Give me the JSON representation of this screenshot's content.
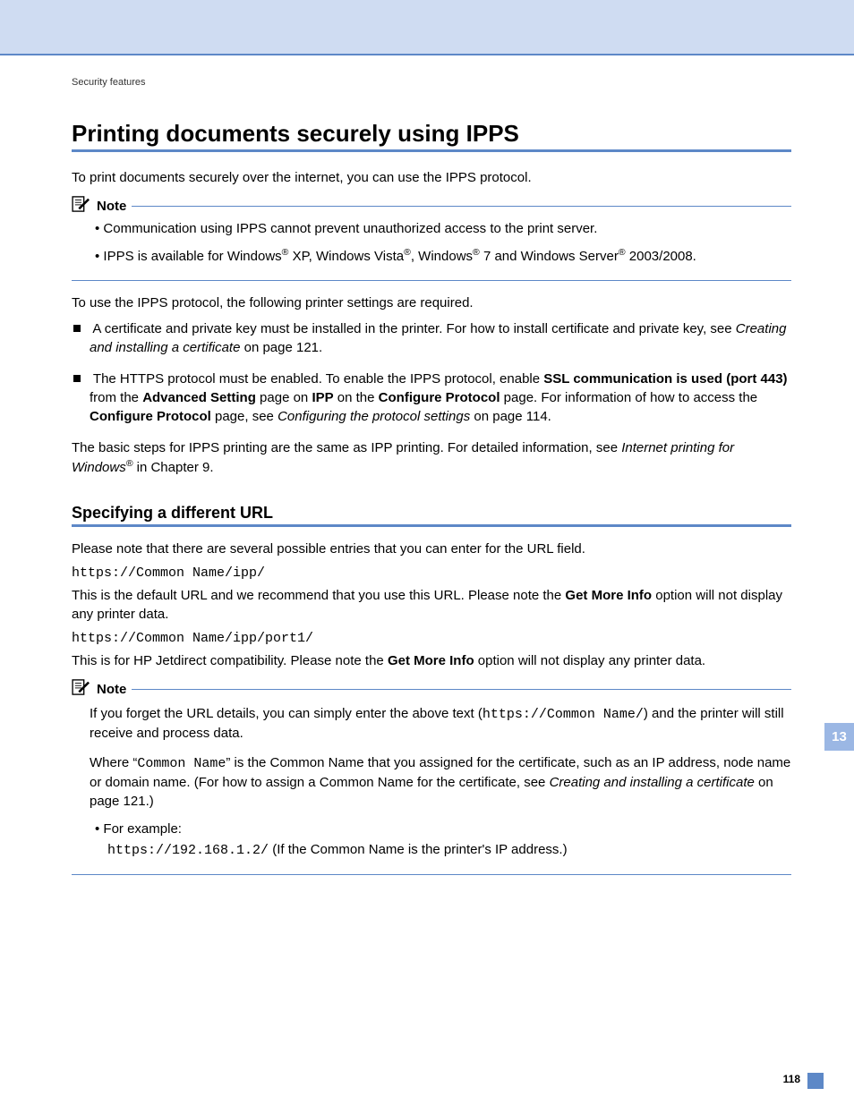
{
  "running_head": "Security features",
  "h1": "Printing documents securely using IPPS",
  "intro": "To print documents securely over the internet, you can use the IPPS protocol.",
  "note1": {
    "label": "Note",
    "b1": "Communication using IPPS cannot prevent unauthorized access to the print server.",
    "b2_pre": "IPPS is available for Windows",
    "b2_mid1": " XP, Windows Vista",
    "b2_mid2": ", Windows",
    "b2_mid3": " 7 and Windows Server",
    "b2_post": " 2003/2008."
  },
  "req_intro": "To use the IPPS protocol, the following printer settings are required.",
  "req": {
    "li1_a": "A certificate and private key must be installed in the printer. For how to install certificate and private key, see ",
    "li1_em": "Creating and installing a certificate",
    "li1_b": " on page 121.",
    "li2_a": "The HTTPS protocol must be enabled. To enable the IPPS protocol, enable ",
    "li2_b1": "SSL communication is used (port 443)",
    "li2_c": " from the ",
    "li2_b2": "Advanced Setting",
    "li2_d": " page on ",
    "li2_b3": "IPP",
    "li2_e": " on the ",
    "li2_b4": "Configure Protocol",
    "li2_f": " page. For information of how to access the ",
    "li2_b5": "Configure Protocol",
    "li2_g": " page, see ",
    "li2_em": "Configuring the protocol settings",
    "li2_h": " on page 114."
  },
  "basic_a": "The basic steps for IPPS printing are the same as IPP printing. For detailed information, see ",
  "basic_em": "Internet printing for Windows",
  "basic_b": " in Chapter 9.",
  "h2": "Specifying a different URL",
  "url_intro": "Please note that there are several possible entries that you can enter for the URL field.",
  "url1": "https://Common Name/ipp/",
  "url1_desc_a": "This is the default URL and we recommend that you use this URL. Please note the ",
  "url1_desc_b": "Get More Info",
  "url1_desc_c": " option will not display any printer data.",
  "url2": "https://Common Name/ipp/port1/",
  "url2_desc_a": "This is for HP Jetdirect compatibility. Please note the ",
  "url2_desc_b": "Get More Info",
  "url2_desc_c": " option will not display any printer data.",
  "note2": {
    "label": "Note",
    "p1_a": "If you forget the URL details, you can simply enter the above text (",
    "p1_code": "https://Common Name/",
    "p1_b": ") and the printer will still receive and process data.",
    "p2_a": "Where “",
    "p2_code": "Common Name",
    "p2_b": "” is the Common Name that you assigned for the certificate, such as an IP address, node name or domain name. (For how to assign a Common Name for the certificate, see ",
    "p2_em": "Creating and installing a certificate",
    "p2_c": " on page 121.)",
    "ex_label": "For example:",
    "ex_code": "https://192.168.1.2/",
    "ex_text": " (If the Common Name is the printer's IP address.)"
  },
  "chapter_tab": "13",
  "page_no": "118",
  "reg": "®"
}
